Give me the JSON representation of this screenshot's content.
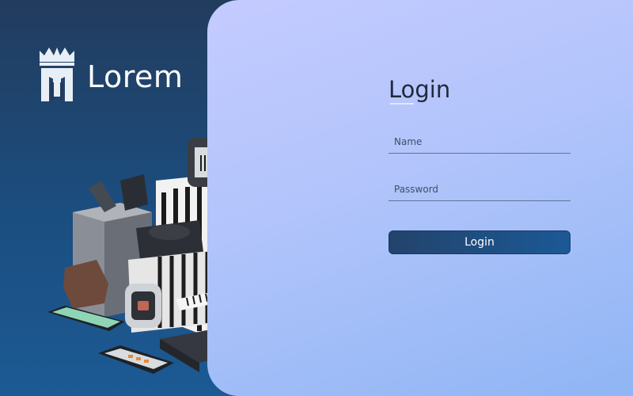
{
  "brand": {
    "name": "Lorem",
    "logo_icon": "castle-crown-logo"
  },
  "login": {
    "title": "Login",
    "name_placeholder": "Name",
    "password_placeholder": "Password",
    "submit_label": "Login"
  },
  "colors": {
    "left_background": "#1f4a78",
    "panel_gradient_start": "#c4cbff",
    "panel_gradient_end": "#8fb5f4",
    "button": "#1f4f86"
  },
  "illustration": {
    "subject": "stacked-devices-illustration"
  }
}
